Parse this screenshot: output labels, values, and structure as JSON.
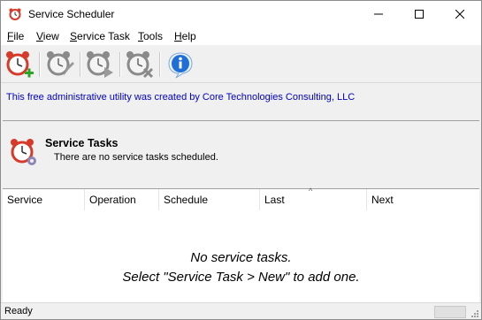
{
  "window": {
    "title": "Service Scheduler",
    "controls": [
      "minimize",
      "maximize",
      "close"
    ]
  },
  "menu": [
    {
      "label": "File"
    },
    {
      "label": "View"
    },
    {
      "label": "Service Task"
    },
    {
      "label": "Tools"
    },
    {
      "label": "Help"
    }
  ],
  "toolbar": {
    "buttons": [
      {
        "icon": "clock-add-icon"
      },
      {
        "icon": "clock-edit-icon"
      },
      {
        "icon": "clock-run-icon"
      },
      {
        "icon": "clock-delete-icon"
      },
      {
        "icon": "info-icon"
      }
    ]
  },
  "credit_text": "This free administrative utility was created by Core Technologies Consulting, LLC",
  "header": {
    "title": "Service Tasks",
    "subtitle": "There are no service tasks scheduled."
  },
  "table": {
    "columns": [
      "Service",
      "Operation",
      "Schedule",
      "Last",
      "Next"
    ],
    "sorted_column": "Last",
    "rows": []
  },
  "empty_state": {
    "line1": "No service tasks.",
    "line2": "Select \"Service Task > New\" to add one."
  },
  "status": {
    "text": "Ready"
  },
  "colors": {
    "credit_link": "#0000c8",
    "clock_red": "#d63a2a",
    "info_blue": "#1f6fd6"
  }
}
